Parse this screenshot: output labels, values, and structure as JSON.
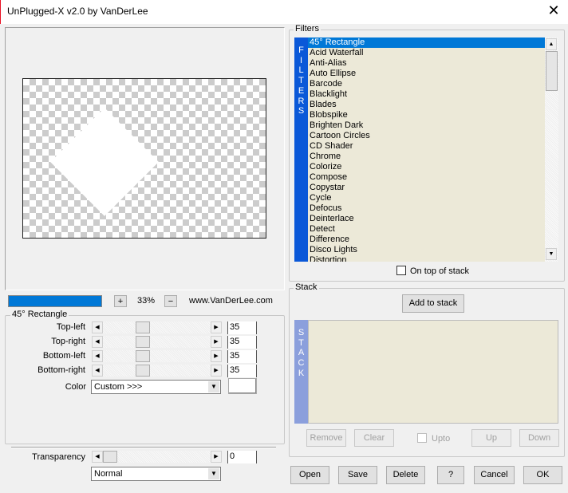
{
  "window": {
    "title": "UnPlugged-X v2.0 by VanDerLee",
    "close": "✕"
  },
  "preview": {
    "zoom": "33%",
    "zoom_in": "+",
    "zoom_out": "−",
    "website": "www.VanDerLee.com",
    "progress": 1.0
  },
  "params": {
    "group_title": "45° Rectangle",
    "sliders": [
      {
        "label": "Top-left",
        "value": "35"
      },
      {
        "label": "Top-right",
        "value": "35"
      },
      {
        "label": "Bottom-left",
        "value": "35"
      },
      {
        "label": "Bottom-right",
        "value": "35"
      }
    ],
    "slider_range": [
      0,
      100
    ],
    "color_label": "Color",
    "color_value": "Custom >>>",
    "transparency_label": "Transparency",
    "transparency_value": "0",
    "blend_mode": "Normal"
  },
  "filters": {
    "group_title": "Filters",
    "side_label": [
      "F",
      "I",
      "L",
      "T",
      "E",
      "R",
      "S"
    ],
    "items": [
      "45° Rectangle",
      "Acid Waterfall",
      "Anti-Alias",
      "Auto Ellipse",
      "Barcode",
      "Blacklight",
      "Blades",
      "Blobspike",
      "Brighten Dark",
      "Cartoon Circles",
      "CD Shader",
      "Chrome",
      "Colorize",
      "Compose",
      "Copystar",
      "Cycle",
      "Defocus",
      "Deinterlace",
      "Detect",
      "Difference",
      "Disco Lights",
      "Distortion"
    ],
    "selected": "45° Rectangle",
    "on_top_label": "On top of stack"
  },
  "stack": {
    "group_title": "Stack",
    "add": "Add to stack",
    "side_label": [
      "S",
      "T",
      "A",
      "C",
      "K"
    ],
    "remove": "Remove",
    "clear": "Clear",
    "upto": "Upto",
    "up": "Up",
    "down": "Down"
  },
  "footer": {
    "open": "Open",
    "save": "Save",
    "delete": "Delete",
    "help": "?",
    "cancel": "Cancel",
    "ok": "OK"
  },
  "colors": {
    "accent": "#0078d7",
    "filters_side": "#0a58d8",
    "stack_side": "#8b9fdc",
    "list_bg": "#ece9d8"
  }
}
